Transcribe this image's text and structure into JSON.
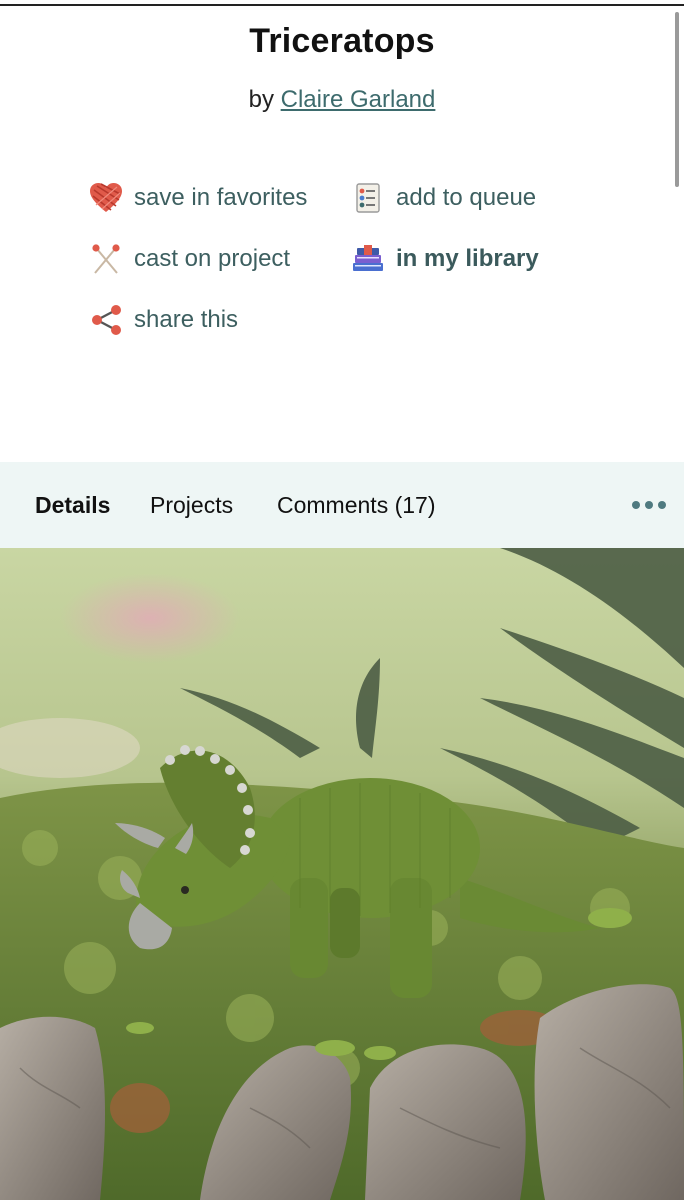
{
  "pattern": {
    "title": "Triceratops",
    "by_prefix": "by",
    "designer": "Claire Garland"
  },
  "actions": {
    "save_favorites": "save in favorites",
    "add_queue": "add to queue",
    "cast_on": "cast on project",
    "library": "in my library",
    "share": "share this"
  },
  "tabs": {
    "details": "Details",
    "projects": "Projects",
    "comments": "Comments (17)"
  },
  "colors": {
    "link": "#3d6b6d",
    "tabbar_bg": "#eef6f5",
    "heart": "#e05a4a"
  },
  "icons": {
    "save_favorites": "yarn-heart-icon",
    "add_queue": "queue-list-icon",
    "cast_on": "knitting-needles-icon",
    "library": "books-icon",
    "share": "share-icon",
    "more": "more-dots-icon"
  }
}
